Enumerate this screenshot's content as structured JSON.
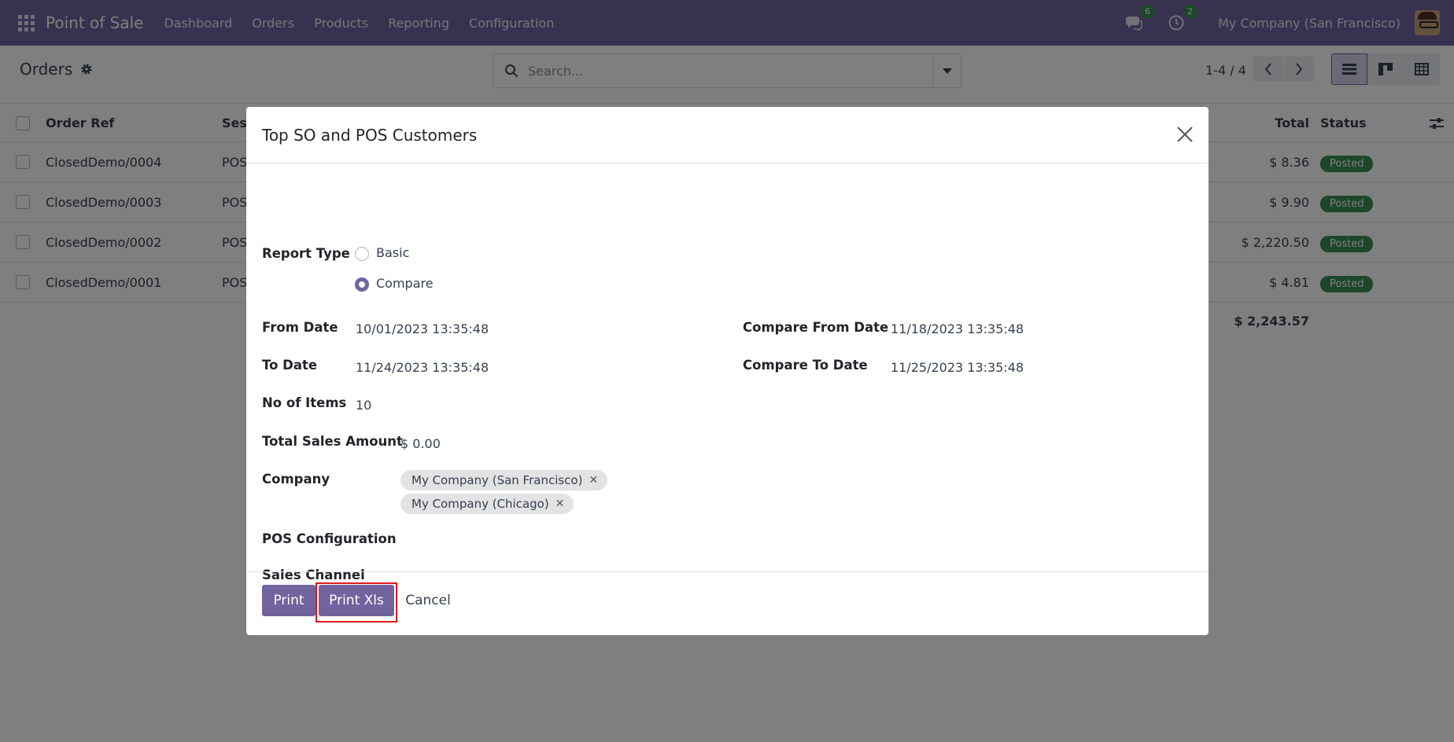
{
  "navbar": {
    "brand": "Point of Sale",
    "menu": [
      "Dashboard",
      "Orders",
      "Products",
      "Reporting",
      "Configuration"
    ],
    "messages_count": "6",
    "activities_count": "2",
    "company": "My Company (San Francisco)"
  },
  "control_panel": {
    "title": "Orders",
    "search_placeholder": "Search...",
    "pager": "1-4 / 4"
  },
  "list": {
    "columns": {
      "ref": "Order Ref",
      "session": "Sess",
      "total": "Total",
      "status": "Status"
    },
    "rows": [
      {
        "ref": "ClosedDemo/0004",
        "session": "POS",
        "total": "$ 8.36",
        "status": "Posted"
      },
      {
        "ref": "ClosedDemo/0003",
        "session": "POS",
        "total": "$ 9.90",
        "status": "Posted"
      },
      {
        "ref": "ClosedDemo/0002",
        "session": "POS",
        "total": "$ 2,220.50",
        "status": "Posted"
      },
      {
        "ref": "ClosedDemo/0001",
        "session": "POS",
        "total": "$ 4.81",
        "status": "Posted"
      }
    ],
    "grand_total": "$ 2,243.57"
  },
  "dialog": {
    "title": "Top SO and POS Customers",
    "report_type_label": "Report Type",
    "report_type_options": [
      "Basic",
      "Compare"
    ],
    "report_type_selected": "Compare",
    "from_date_label": "From Date",
    "from_date": "10/01/2023 13:35:48",
    "to_date_label": "To Date",
    "to_date": "11/24/2023 13:35:48",
    "compare_from_label": "Compare From Date",
    "compare_from": "11/18/2023 13:35:48",
    "compare_to_label": "Compare To Date",
    "compare_to": "11/25/2023 13:35:48",
    "no_items_label": "No of Items",
    "no_items": "10",
    "total_sales_label": "Total Sales Amount",
    "total_sales": "$ 0.00",
    "company_label": "Company",
    "companies": [
      "My Company (San Francisco)",
      "My Company (Chicago)"
    ],
    "pos_config_label": "POS Configuration",
    "sales_channel_label": "Sales Channel",
    "buttons": {
      "print": "Print",
      "print_xls": "Print Xls",
      "cancel": "Cancel"
    }
  }
}
